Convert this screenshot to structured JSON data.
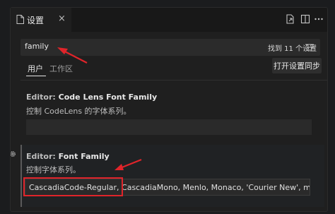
{
  "window": {
    "tab_label": "设置",
    "tab_close": "×"
  },
  "search": {
    "value": "family",
    "result_count": "找到 11 个设置"
  },
  "scopes": {
    "user": "用户",
    "workspace": "工作区",
    "sync_button": "打开设置同步"
  },
  "settings": [
    {
      "category": "Editor:",
      "name": "Code Lens Font Family",
      "description": "控制 CodeLens 的字体系列。",
      "value": ""
    },
    {
      "category": "Editor:",
      "name": "Font Family",
      "description": "控制字体系列。",
      "value": "CascadiaCode-Regular, CascadiaMono, Menlo, Monaco, 'Courier New', monospace"
    }
  ],
  "icons": {
    "tab": "settings-file-icon",
    "open_json": "open-json-icon",
    "split": "split-editor-icon",
    "more": "more-actions-icon",
    "filter": "filter-icon",
    "gear": "gear-icon"
  },
  "colors": {
    "annotation": "#e0242a",
    "background": "#1f1f1f"
  }
}
